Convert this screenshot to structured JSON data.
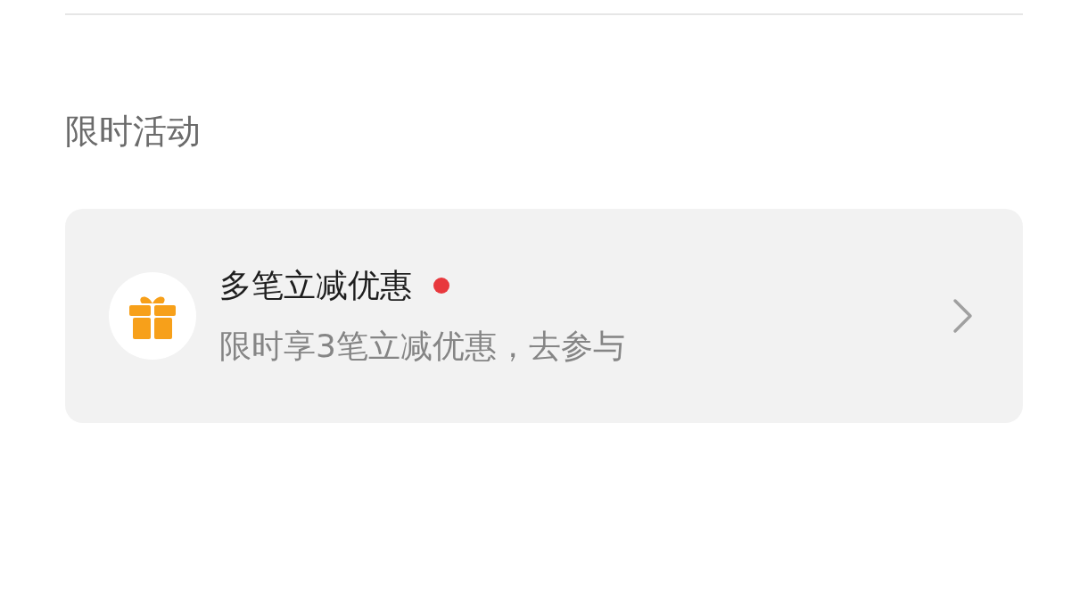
{
  "section_title": "限时活动",
  "activity": {
    "title": "多笔立减优惠",
    "unread": true,
    "subtitle": "限时享3笔立减优惠，去参与"
  }
}
